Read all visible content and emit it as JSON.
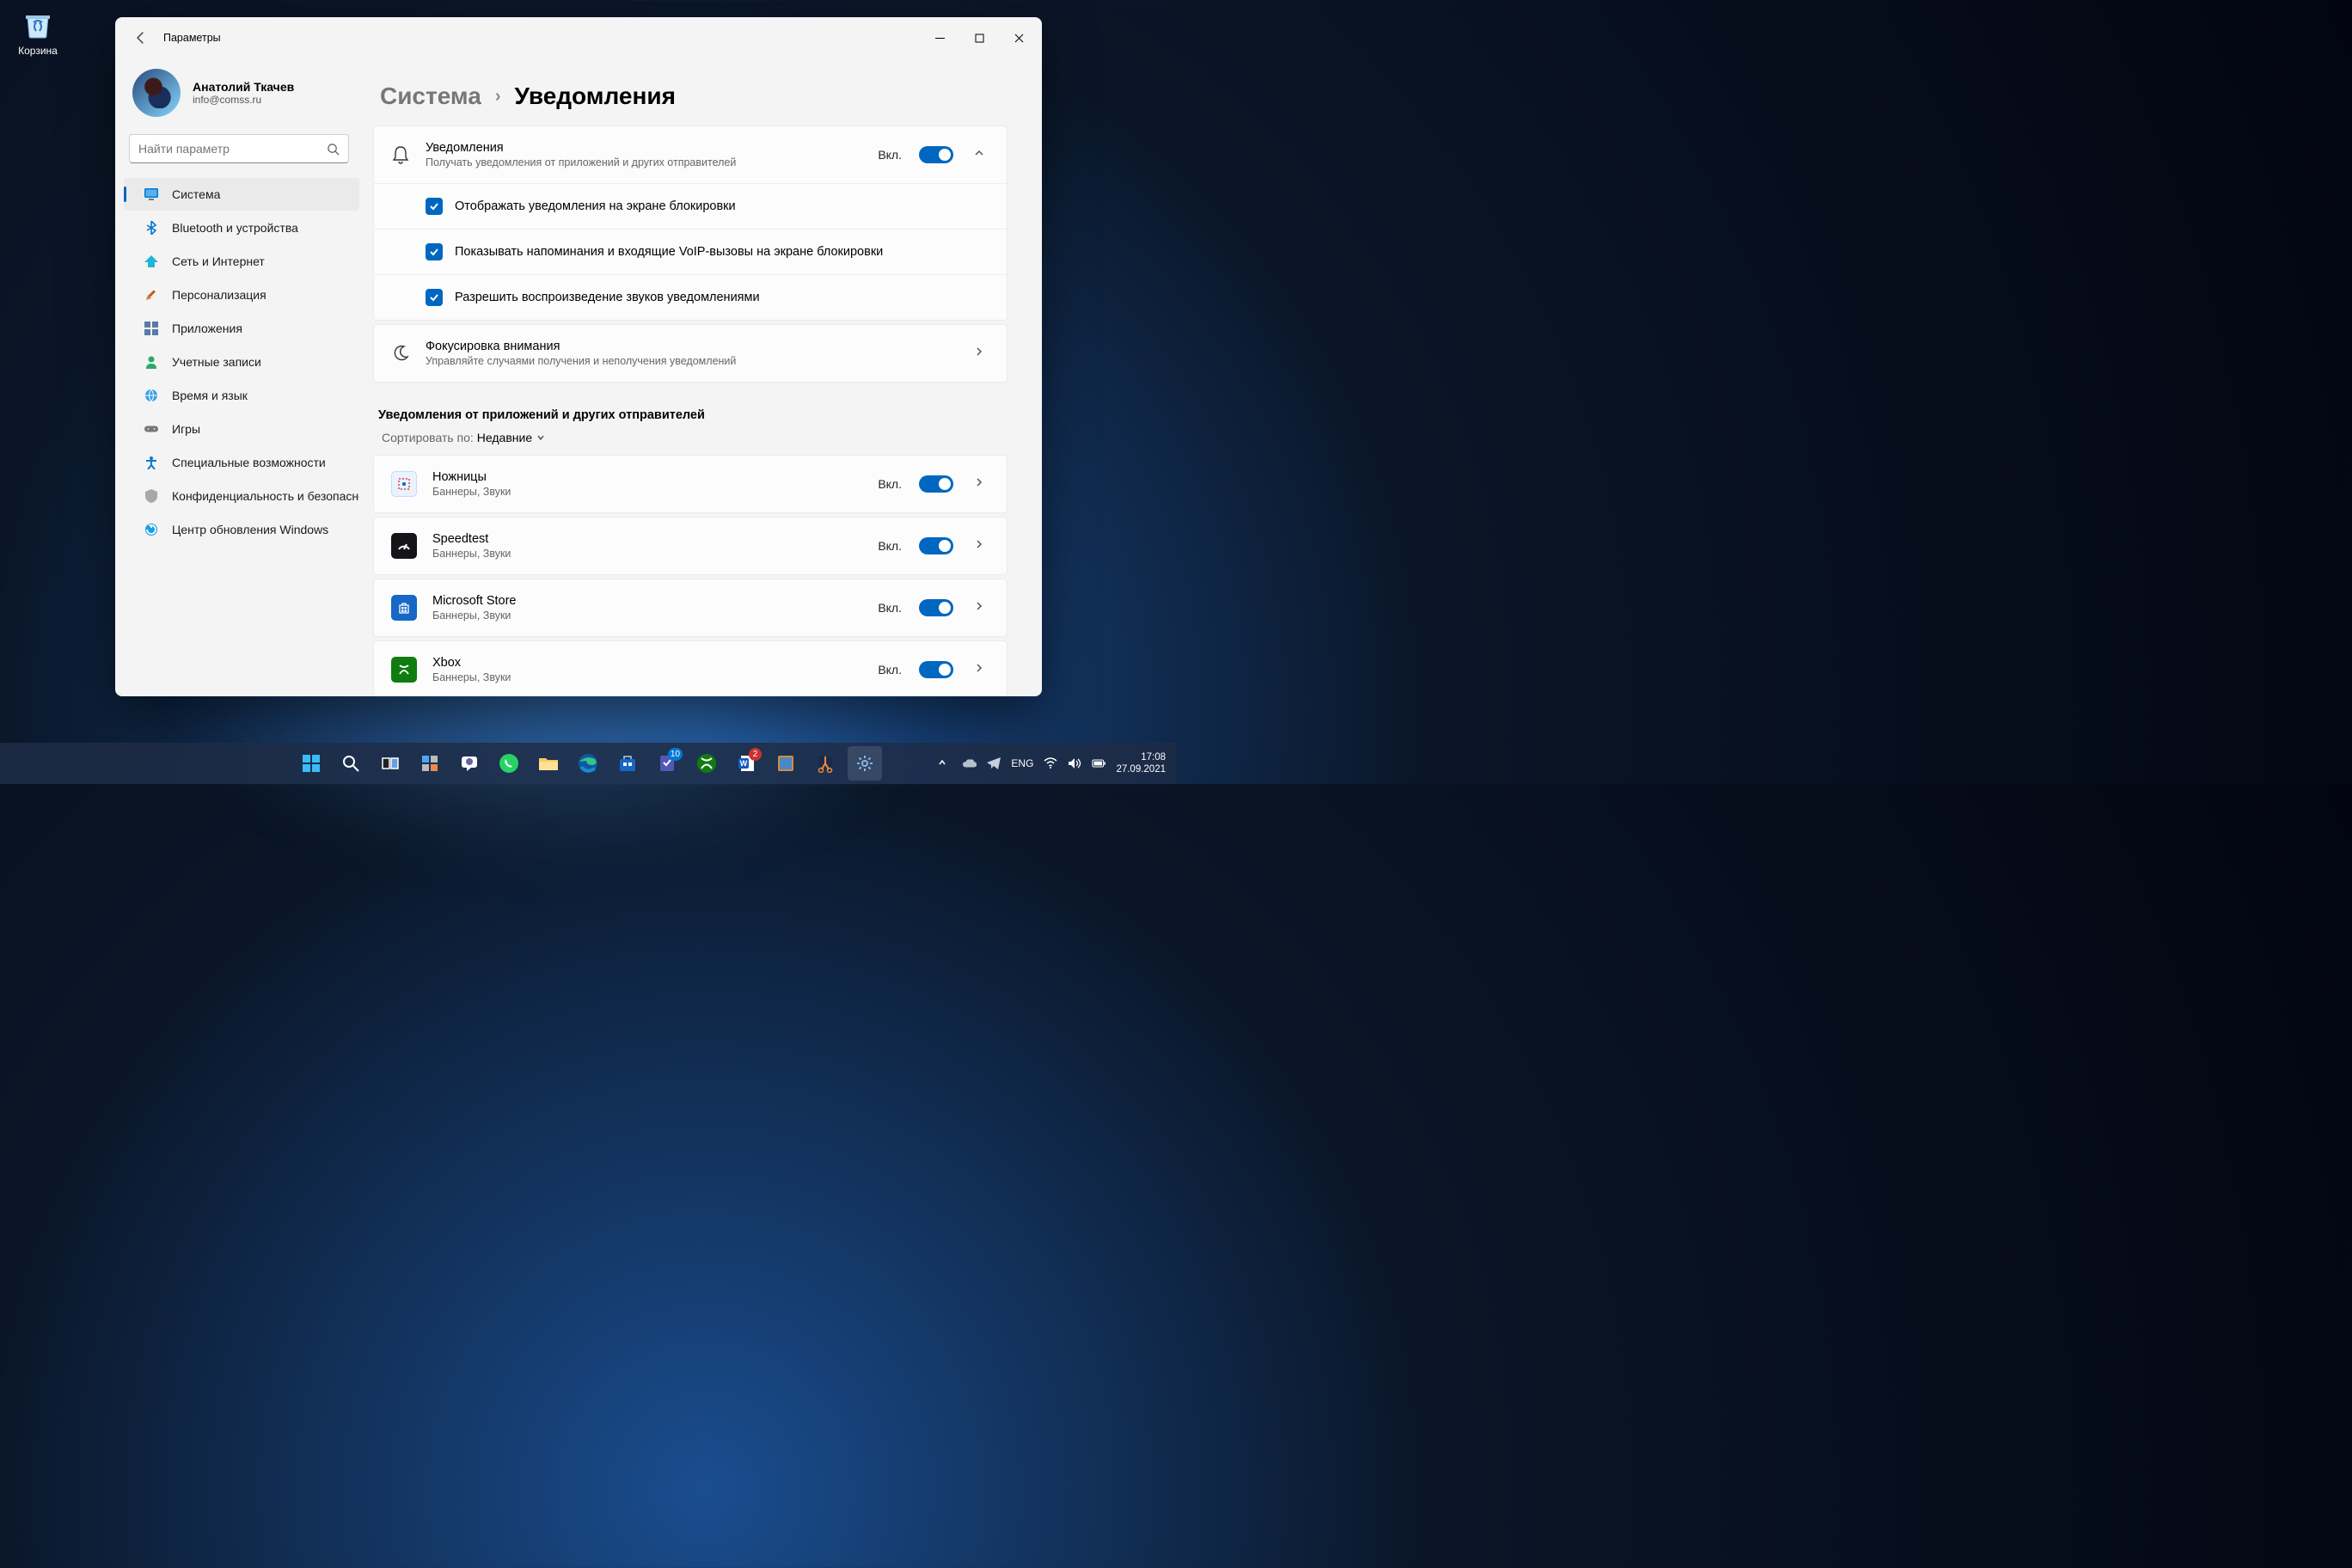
{
  "desktop": {
    "recycle_bin": "Корзина"
  },
  "window": {
    "title": "Параметры",
    "user": {
      "name": "Анатолий Ткачев",
      "email": "info@comss.ru"
    },
    "search_placeholder": "Найти параметр",
    "nav": [
      {
        "label": "Система",
        "active": true
      },
      {
        "label": "Bluetooth и устройства"
      },
      {
        "label": "Сеть и Интернет"
      },
      {
        "label": "Персонализация"
      },
      {
        "label": "Приложения"
      },
      {
        "label": "Учетные записи"
      },
      {
        "label": "Время и язык"
      },
      {
        "label": "Игры"
      },
      {
        "label": "Специальные возможности"
      },
      {
        "label": "Конфиденциальность и безопасность"
      },
      {
        "label": "Центр обновления Windows"
      }
    ],
    "breadcrumb": {
      "parent": "Система",
      "current": "Уведомления"
    },
    "notifications_card": {
      "title": "Уведомления",
      "sub": "Получать уведомления от приложений и других отправителей",
      "state": "Вкл.",
      "checks": [
        "Отображать уведомления на экране блокировки",
        "Показывать напоминания и входящие VoIP-вызовы на экране блокировки",
        "Разрешить  воспроизведение звуков уведомлениями"
      ]
    },
    "focus_card": {
      "title": "Фокусировка внимания",
      "sub": "Управляйте случаями получения и неполучения уведомлений"
    },
    "apps_section": {
      "heading": "Уведомления от приложений и других отправителей",
      "sort_label": "Сортировать по:",
      "sort_value": "Недавние",
      "apps": [
        {
          "name": "Ножницы",
          "sub": "Баннеры, Звуки",
          "state": "Вкл."
        },
        {
          "name": "Speedtest",
          "sub": "Баннеры, Звуки",
          "state": "Вкл."
        },
        {
          "name": "Microsoft Store",
          "sub": "Баннеры, Звуки",
          "state": "Вкл."
        },
        {
          "name": "Xbox",
          "sub": "Баннеры, Звуки",
          "state": "Вкл."
        }
      ]
    }
  },
  "taskbar": {
    "lang": "ENG",
    "time": "17:08",
    "date": "27.09.2021",
    "badges": {
      "todo": "10",
      "word": "2"
    }
  }
}
